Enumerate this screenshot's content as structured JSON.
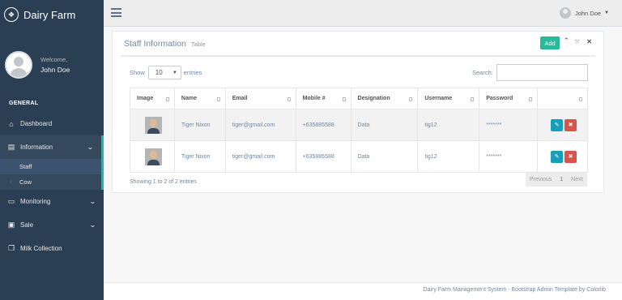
{
  "brand": {
    "name": "Dairy Farm",
    "icon": "paw-icon"
  },
  "profile": {
    "welcome": "Welcome,",
    "name": "John Doe"
  },
  "sidebar": {
    "section": "GENERAL",
    "items": [
      {
        "label": "Dashboard",
        "icon": "home-icon"
      },
      {
        "label": "Information",
        "icon": "table-icon"
      },
      {
        "label": "Monitoring",
        "icon": "desktop-icon"
      },
      {
        "label": "Sale",
        "icon": "money-icon"
      },
      {
        "label": "Milk Collection",
        "icon": "cart-icon"
      }
    ],
    "submenu": [
      "Staff",
      "Cow"
    ]
  },
  "topnav": {
    "user": "John Doe"
  },
  "panel": {
    "title": "Staff Information",
    "subtitle": "Table",
    "add_label": "Add",
    "show_label": "Show",
    "show_value": "10",
    "entries_label": "entries",
    "search_label": "Search:"
  },
  "table": {
    "headers": [
      "Image",
      "Name",
      "Email",
      "Mobile #",
      "Designation",
      "Username",
      "Password",
      ""
    ],
    "rows": [
      {
        "name": "Tiger Nixon",
        "email": "tiger@gmail.com",
        "mobile": "+635885588",
        "designation": "Data",
        "username": "tig12",
        "password": "*******"
      },
      {
        "name": "Tiger Nixon",
        "email": "tiger@gmail.com",
        "mobile": "+635885588",
        "designation": "Data",
        "username": "tig12",
        "password": "*******"
      }
    ]
  },
  "showing": "Showing 1 to 2 of 2 entries",
  "pager": {
    "prev": "Previous",
    "page": "1",
    "next": "Next"
  },
  "footer": "Dairy Farm Management System - Bootstrap Admin Template by Colorlib",
  "colors": {
    "accent": "#26b99a",
    "sidebar": "#2a3f54",
    "edit": "#169fb6",
    "delete": "#d9534f"
  }
}
